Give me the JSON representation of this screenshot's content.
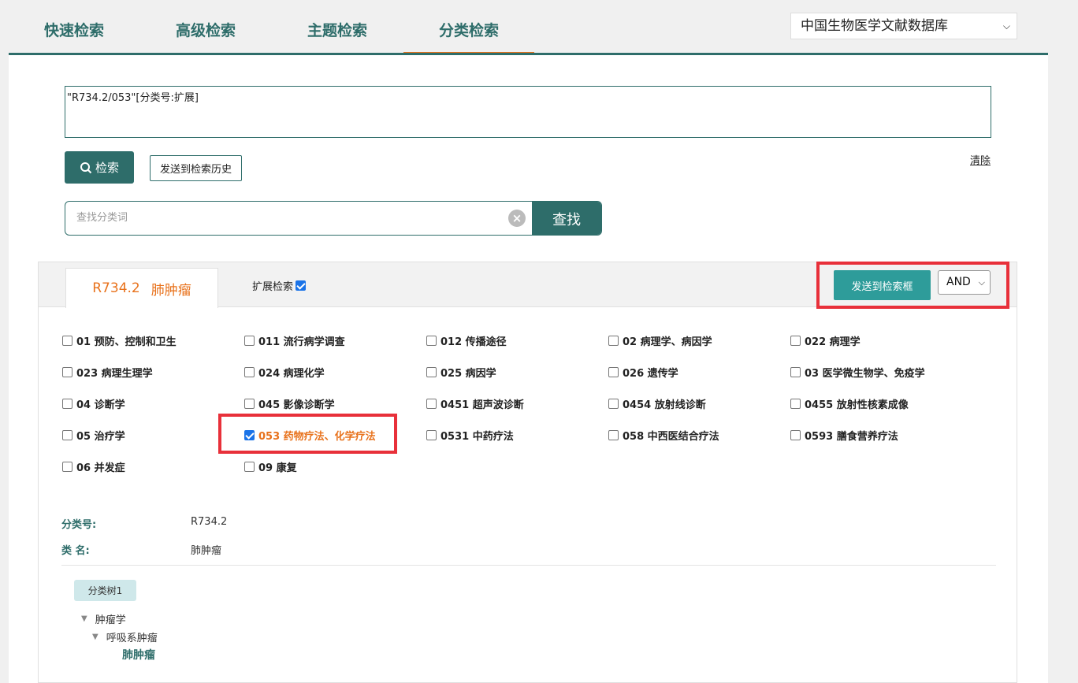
{
  "nav": {
    "tabs": [
      {
        "label": "快速检索"
      },
      {
        "label": "高级检索"
      },
      {
        "label": "主题检索"
      },
      {
        "label": "分类检索"
      }
    ],
    "database": "中国生物医学文献数据库"
  },
  "query": {
    "text": "\"R734.2/053\"[分类号:扩展]",
    "search_label": "检索",
    "history_label": "发送到检索历史",
    "clear_label": "清除"
  },
  "find": {
    "placeholder": "查找分类词",
    "button_label": "查找"
  },
  "category": {
    "code": "R734.2",
    "name": "肺肿瘤",
    "expand_label": "扩展检索",
    "expand_checked": true,
    "send_label": "发送到检索框",
    "operator": "AND"
  },
  "subheadings": [
    {
      "label": "01 预防、控制和卫生",
      "checked": false
    },
    {
      "label": "011 流行病学调查",
      "checked": false
    },
    {
      "label": "012 传播途径",
      "checked": false
    },
    {
      "label": "02 病理学、病因学",
      "checked": false
    },
    {
      "label": "022 病理学",
      "checked": false
    },
    {
      "label": "023 病理生理学",
      "checked": false
    },
    {
      "label": "024 病理化学",
      "checked": false
    },
    {
      "label": "025 病因学",
      "checked": false
    },
    {
      "label": "026 遗传学",
      "checked": false
    },
    {
      "label": "03 医学微生物学、免疫学",
      "checked": false
    },
    {
      "label": "04 诊断学",
      "checked": false
    },
    {
      "label": "045 影像诊断学",
      "checked": false
    },
    {
      "label": "0451 超声波诊断",
      "checked": false
    },
    {
      "label": "0454 放射线诊断",
      "checked": false
    },
    {
      "label": "0455 放射性核素成像",
      "checked": false
    },
    {
      "label": "05 治疗学",
      "checked": false
    },
    {
      "label": "053 药物疗法、化学疗法",
      "checked": true
    },
    {
      "label": "0531 中药疗法",
      "checked": false
    },
    {
      "label": "058 中西医结合疗法",
      "checked": false
    },
    {
      "label": "0593 膳食营养疗法",
      "checked": false
    },
    {
      "label": "06 并发症",
      "checked": false
    },
    {
      "label": "09 康复",
      "checked": false
    }
  ],
  "info": {
    "code_label": "分类号:",
    "code_value": "R734.2",
    "name_label": "类 名:",
    "name_value": "肺肿瘤"
  },
  "tree": {
    "tag": "分类树1",
    "level1": "肿瘤学",
    "level2": "呼吸系肿瘤",
    "leaf": "肺肿瘤"
  },
  "colors": {
    "brand": "#2e6d6a",
    "accent": "#e8721c",
    "highlight": "#e8303a",
    "send_button": "#2e9c9a"
  }
}
